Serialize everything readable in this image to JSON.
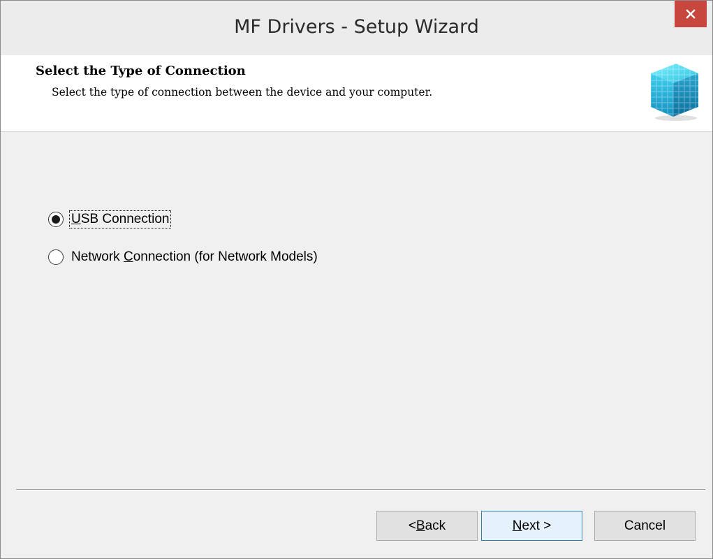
{
  "window": {
    "title": "MF Drivers - Setup Wizard",
    "close_glyph": "×"
  },
  "header": {
    "title": "Select the Type of Connection",
    "subtitle": "Select the type of connection between the device and your computer.",
    "logo_icon": "blue-cube-stack-icon"
  },
  "options": [
    {
      "prefix": "",
      "accel": "U",
      "rest": "SB Connection",
      "selected": true
    },
    {
      "prefix": "Network ",
      "accel": "C",
      "rest": "onnection (for Network Models)",
      "selected": false
    }
  ],
  "buttons": {
    "back": {
      "prefix": "< ",
      "accel": "B",
      "rest": "ack"
    },
    "next": {
      "prefix": "",
      "accel": "N",
      "rest": "ext >"
    },
    "cancel": {
      "label": "Cancel"
    }
  },
  "colors": {
    "close_button": "#c7473f",
    "cube_primary": "#29b6d9"
  }
}
